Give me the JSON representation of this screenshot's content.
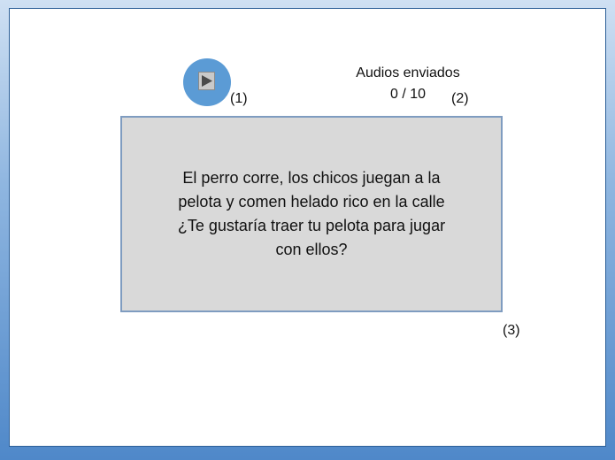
{
  "colors": {
    "play_button": "#5b9bd5",
    "text_box_fill": "#d9d9d9",
    "text_box_border": "#7f9cc0",
    "frame_border": "#4f88c9"
  },
  "player": {
    "icon": "play-icon",
    "marker": "(1)"
  },
  "audios": {
    "label": "Audios enviados",
    "count": "0 / 10",
    "marker": "(2)"
  },
  "text_box": {
    "content": "El perro corre, los chicos juegan a la pelota y comen helado rico en la calle ¿Te gustaría traer tu pelota para jugar con ellos?",
    "marker": "(3)"
  }
}
